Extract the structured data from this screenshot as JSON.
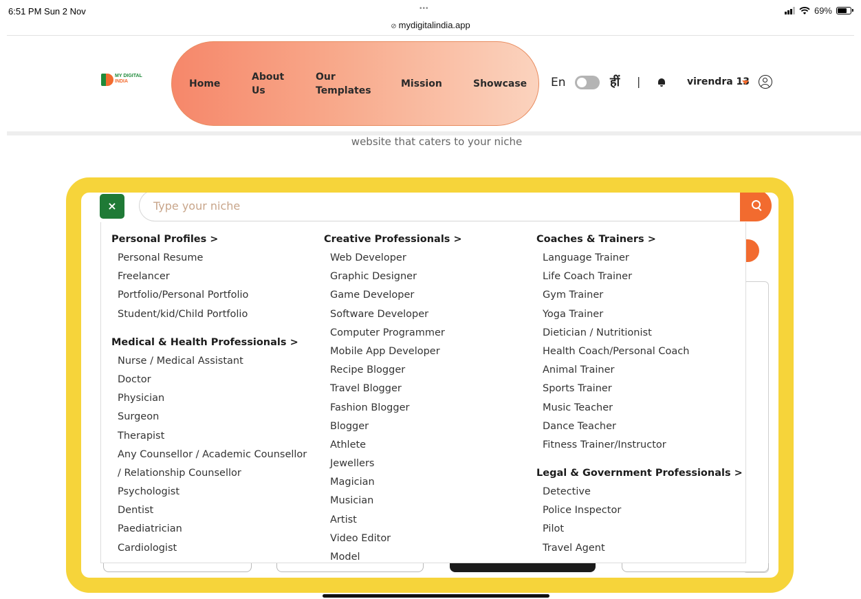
{
  "status_bar": {
    "time": "6:51 PM  Sun 2 Nov",
    "dots": "•••",
    "url": "mydigitalindia.app",
    "battery": "69%"
  },
  "header": {
    "logo_line1": "MY DIGITAL",
    "logo_line2": "INDIA",
    "nav": [
      "Home",
      "About",
      "Us",
      "Our",
      "Templates",
      "Mission",
      "Showcase"
    ],
    "lang": "En",
    "hindi": "हीं",
    "separator": "|",
    "username": "virendra 13"
  },
  "subtitle": "website that caters to your niche",
  "search": {
    "close_label": "×",
    "placeholder": "Type your niche"
  },
  "dropdown": {
    "col1": {
      "heading1": "Personal Profiles >",
      "items1": [
        "Personal Resume",
        "Freelancer",
        "Portfolio/Personal Portfolio",
        "Student/kid/Child Portfolio"
      ],
      "heading2": "Medical & Health Professionals >",
      "items2": [
        "Nurse / Medical Assistant",
        "Doctor",
        "Physician",
        "Surgeon",
        "Therapist",
        "Any Counsellor / Academic Counsellor",
        "/ Relationship Counsellor",
        "Psychologist",
        "Dentist",
        "Paediatrician",
        "Cardiologist"
      ]
    },
    "col2": {
      "heading1": "Creative Professionals >",
      "items1": [
        "Web Developer",
        "Graphic Designer",
        "Game Developer",
        "Software Developer",
        "Computer Programmer",
        "Mobile App Developer",
        "Recipe Blogger",
        "Travel Blogger",
        "Fashion Blogger",
        "Blogger",
        "Athlete",
        "Jewellers",
        "Magician",
        "Musician",
        "Artist",
        "Video Editor",
        "Model"
      ]
    },
    "col3": {
      "heading1": "Coaches & Trainers >",
      "items1": [
        "Language Trainer",
        "Life Coach Trainer",
        "Gym Trainer",
        "Yoga Trainer",
        "Dietician / Nutritionist",
        "Health Coach/Personal Coach",
        "Animal Trainer",
        "Sports Trainer",
        "Music Teacher",
        "Dance Teacher",
        "Fitness Trainer/Instructor"
      ],
      "heading2": "Legal & Government Professionals >",
      "items2": [
        "Detective",
        "Police Inspector",
        "Pilot",
        "Travel Agent"
      ]
    }
  },
  "colors": {
    "accent_orange": "#f26b2f",
    "brand_green": "#1f7a36",
    "highlight_yellow": "#f6d43a"
  },
  "icons": [
    "lock-icon",
    "wifi-icon",
    "signal-icon",
    "battery-icon",
    "bell-icon",
    "caret-down-icon",
    "user-icon",
    "close-icon",
    "search-icon"
  ]
}
